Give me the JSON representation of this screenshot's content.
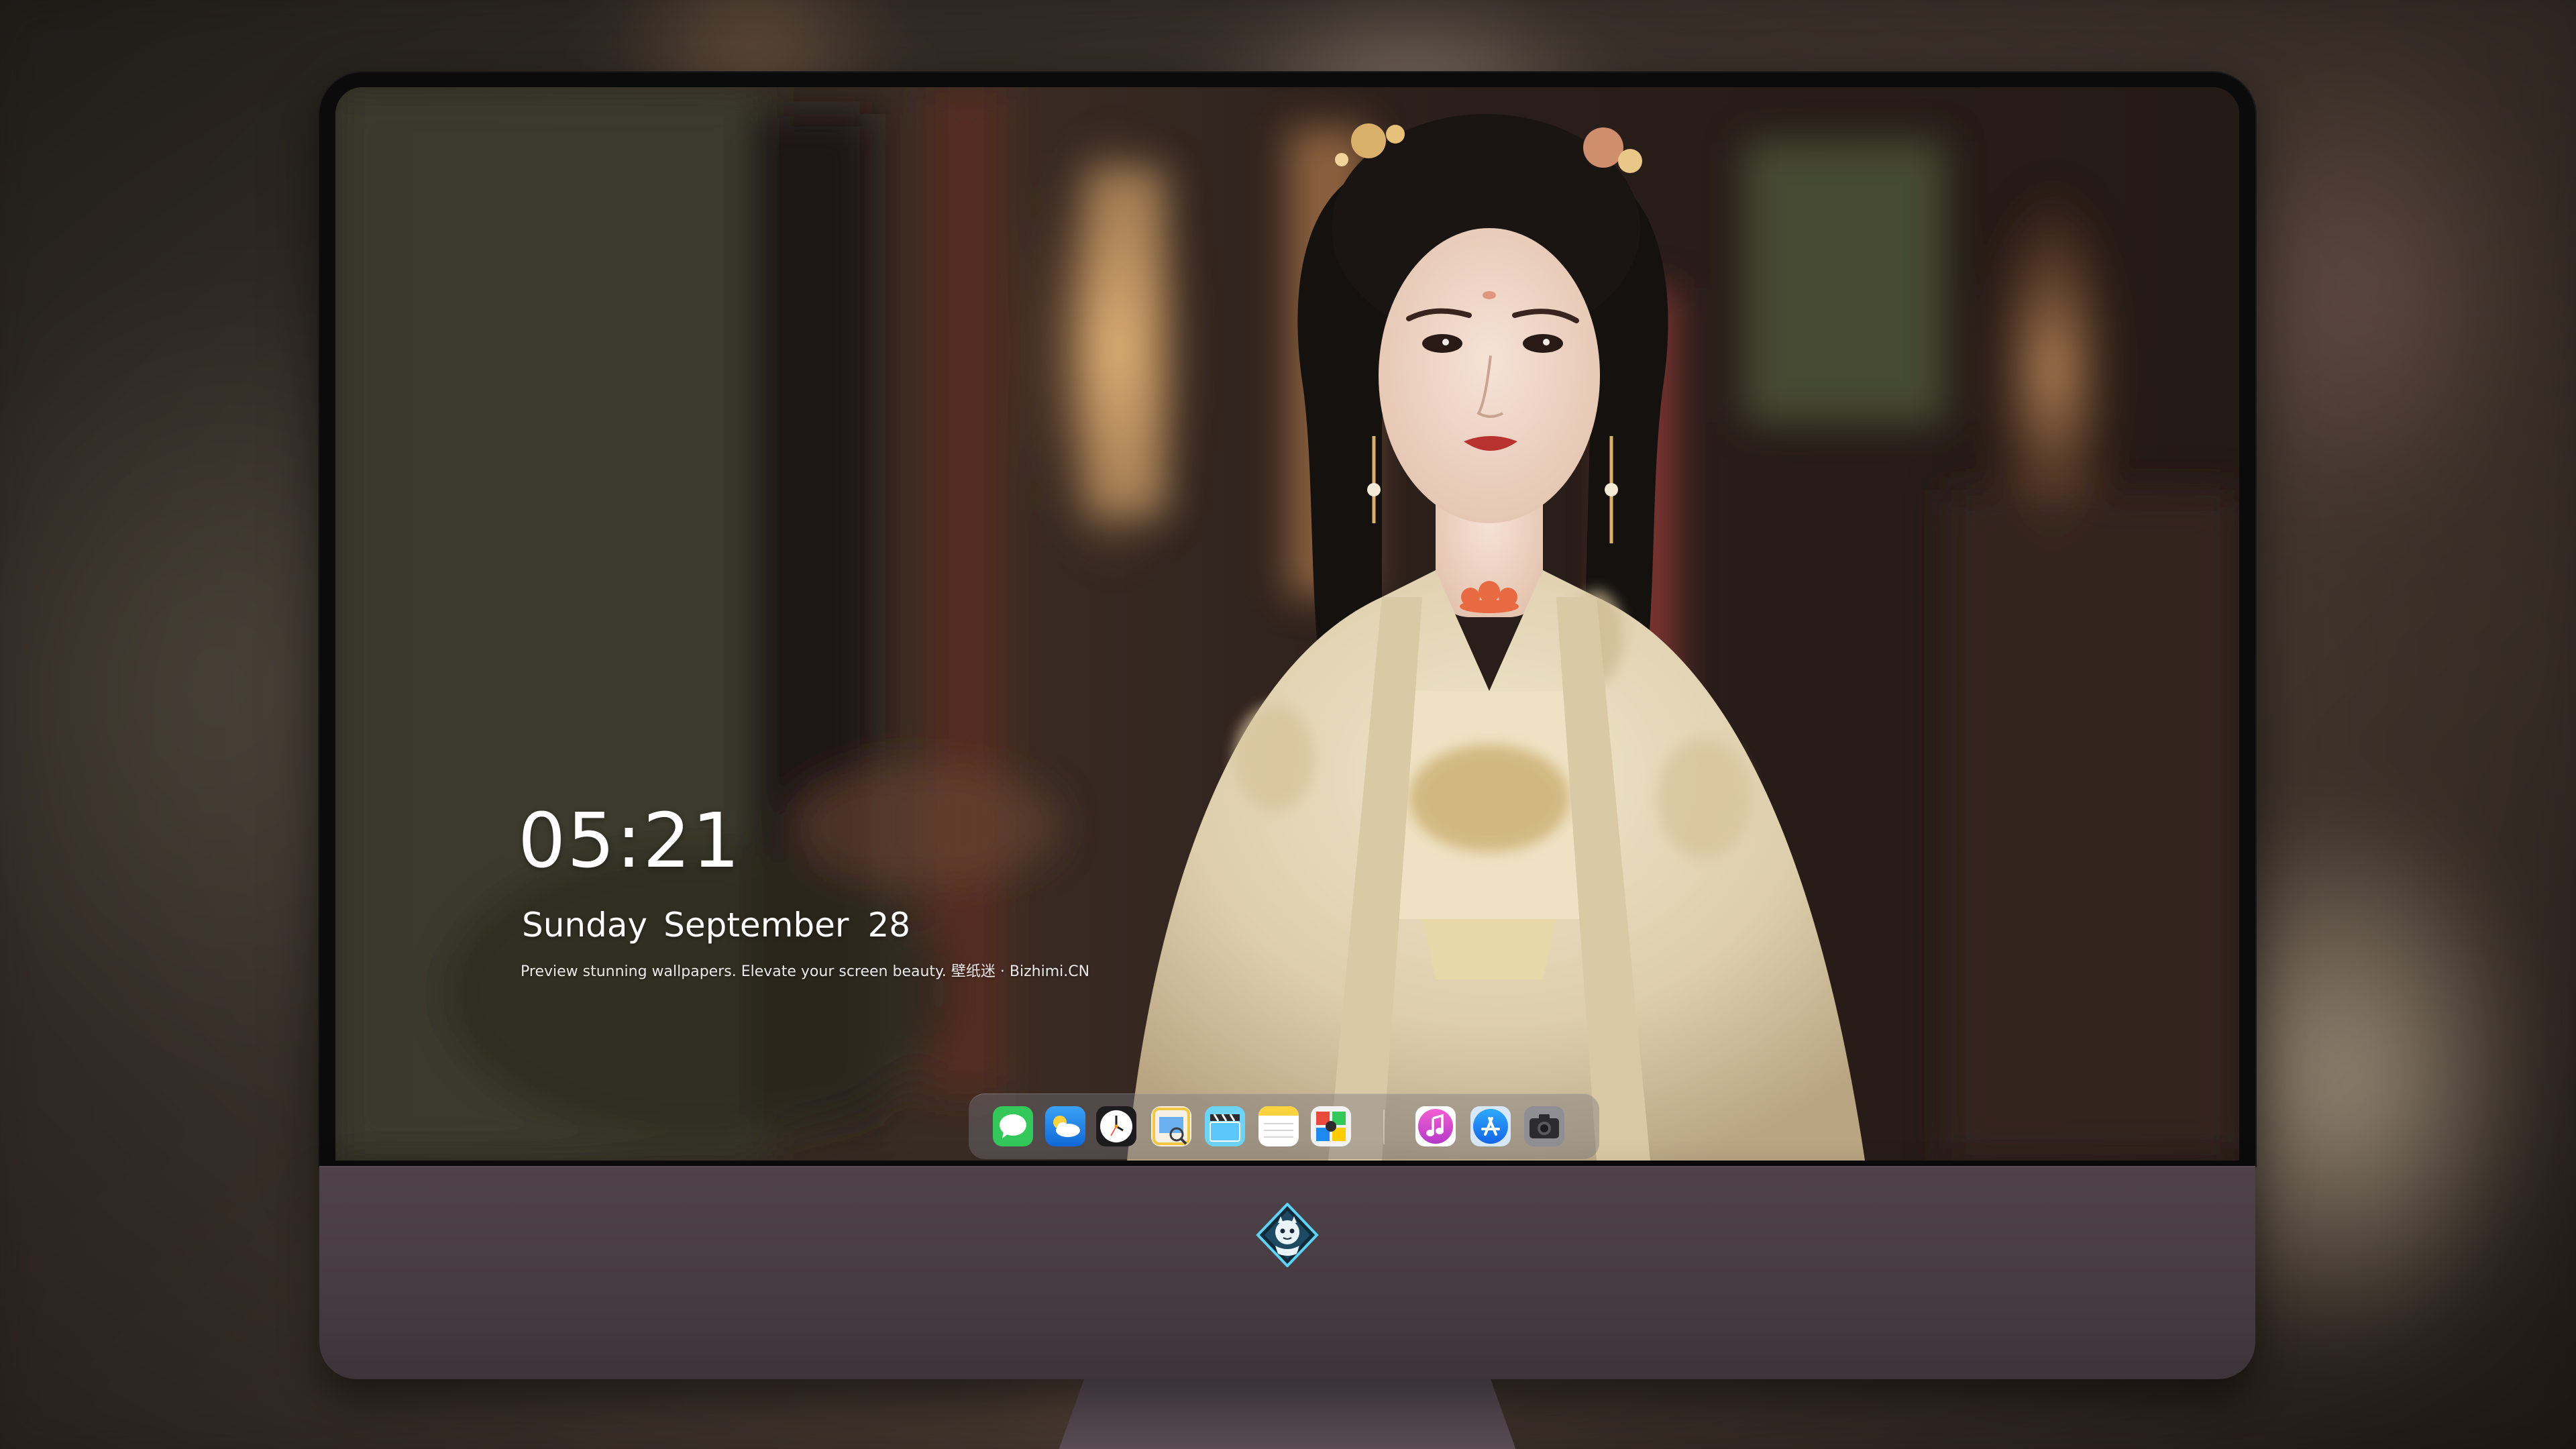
{
  "lock_screen": {
    "time": "05:21",
    "weekday": "Sunday",
    "month": "September",
    "day": "28",
    "tagline": "Preview stunning wallpapers. Elevate your screen beauty. 壁纸迷 · Bizhimi.CN"
  },
  "dock": {
    "apps": [
      {
        "name": "messages-icon",
        "color": "#34c759"
      },
      {
        "name": "weather-icon",
        "color": "#1e8af0"
      },
      {
        "name": "clock-icon",
        "color": "#1c1c1e"
      },
      {
        "name": "preview-icon",
        "color": "#f2c744"
      },
      {
        "name": "video-icon",
        "color": "#5ac8fa"
      },
      {
        "name": "notes-icon",
        "color": "#ffd23f"
      },
      {
        "name": "photo-booth-icon",
        "color": "#e84a3c"
      },
      {
        "name": "music-icon",
        "color": "#e040c8"
      },
      {
        "name": "app-store-icon",
        "color": "#1b8cf5"
      },
      {
        "name": "camera-icon",
        "color": "#6e6e73"
      }
    ]
  },
  "colors": {
    "monitor_chin": "#4a3f45",
    "bezel": "#0b0b0c",
    "text": "#ffffff"
  }
}
